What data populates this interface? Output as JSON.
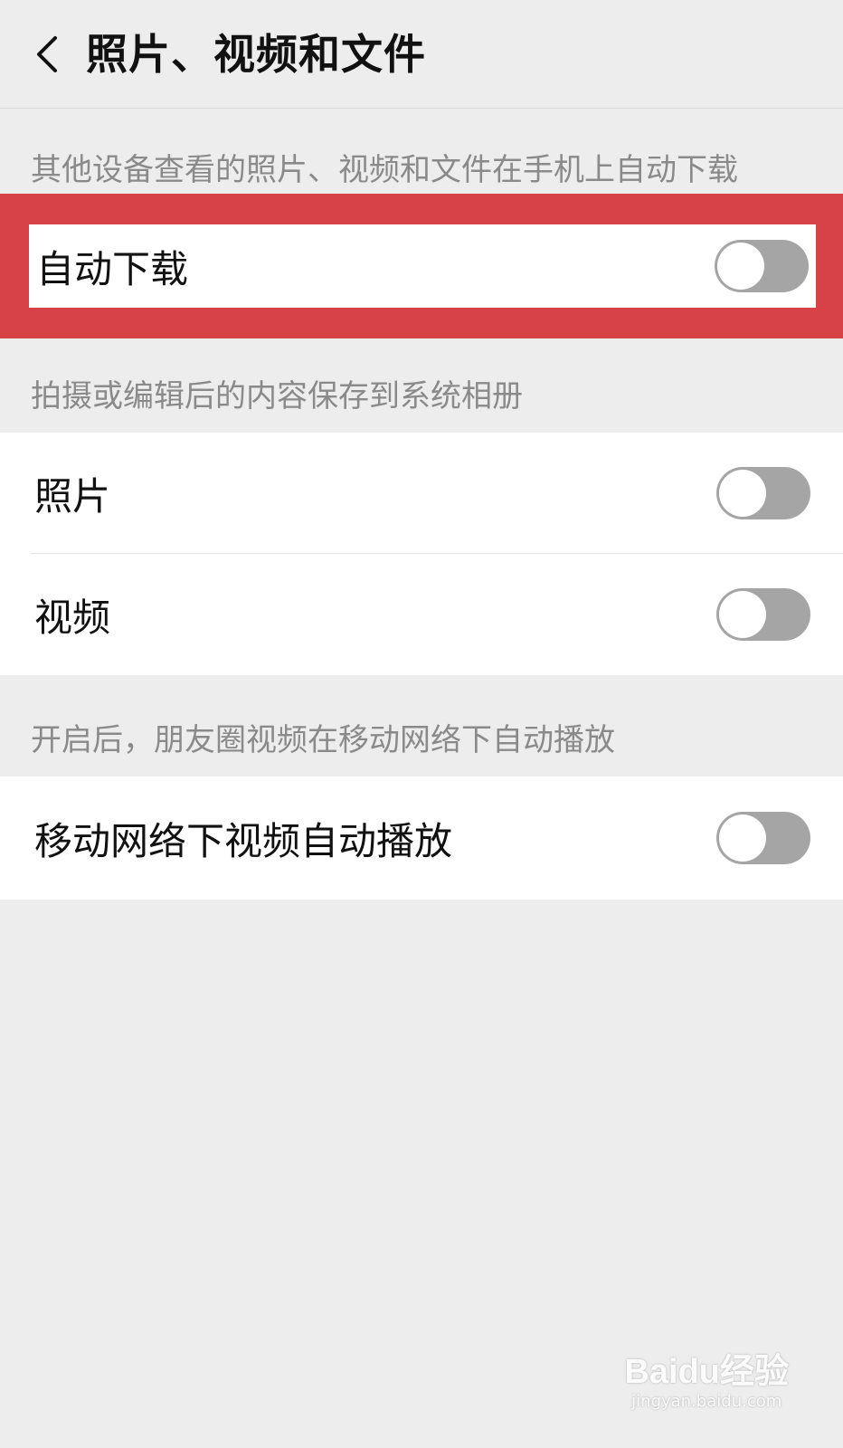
{
  "nav": {
    "title": "照片、视频和文件",
    "back_icon": "chevron-left-icon"
  },
  "sections": [
    {
      "label": "其他设备查看的照片、视频和文件在手机上自动下载",
      "items": [
        {
          "label": "自动下载",
          "toggle_on": false
        }
      ]
    },
    {
      "label": "拍摄或编辑后的内容保存到系统相册",
      "items": [
        {
          "label": "照片",
          "toggle_on": false
        },
        {
          "label": "视频",
          "toggle_on": false
        }
      ]
    },
    {
      "label": "开启后，朋友圈视频在移动网络下自动播放",
      "items": [
        {
          "label": "移动网络下视频自动播放",
          "toggle_on": false
        }
      ]
    }
  ],
  "watermark": {
    "logo": "Baidu经验",
    "url": "jingyan.baidu.com"
  },
  "colors": {
    "background": "#ededed",
    "highlight": "#d64245",
    "toggle_off": "#a5a5a5"
  }
}
